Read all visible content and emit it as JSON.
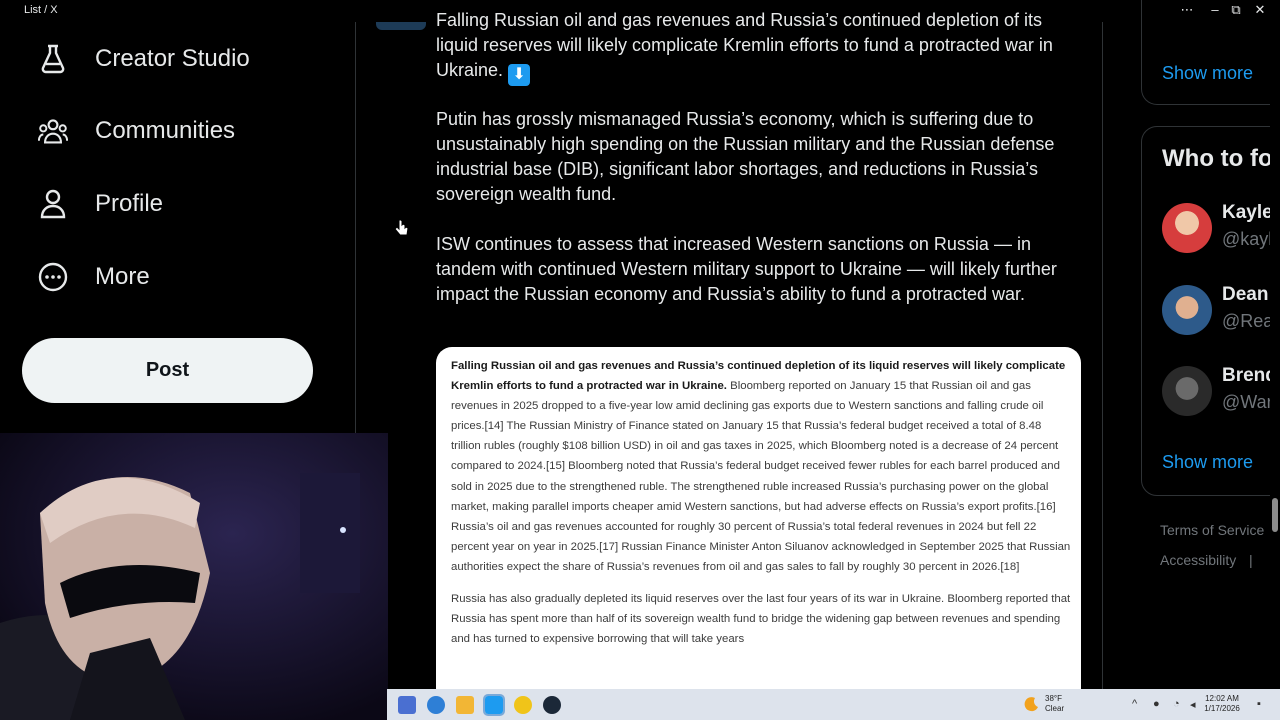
{
  "window": {
    "title": "List / X",
    "controls": [
      "⋯",
      "–",
      "⧉",
      "✕"
    ]
  },
  "nav": {
    "items": [
      {
        "label": "Creator Studio",
        "icon": "flask-icon"
      },
      {
        "label": "Communities",
        "icon": "communities-icon"
      },
      {
        "label": "Profile",
        "icon": "profile-icon"
      },
      {
        "label": "More",
        "icon": "more-circle-icon"
      }
    ],
    "post_label": "Post"
  },
  "post": {
    "paragraphs": [
      "Falling Russian oil and gas revenues and Russia’s continued depletion of its liquid reserves will likely complicate Kremlin efforts to fund a protracted war in Ukraine.",
      "Putin has grossly mismanaged Russia’s economy, which is suffering due to unsustainably high spending on the Russian military and the Russian defense industrial base (DIB), significant labor shortages, and reductions in Russia’s sovereign wealth fund.",
      "ISW continues to assess that increased Western sanctions on Russia — in tandem with continued Western military support to Ukraine — will likely further impact the Russian economy and Russia’s ability to fund a protracted war."
    ],
    "arrow_emoji": "⬇",
    "image": {
      "p1_bold": "Falling Russian oil and gas revenues and Russia’s continued depletion of its liquid reserves will likely complicate Kremlin efforts to fund a protracted war in Ukraine.",
      "p1_rest": " Bloomberg reported on January 15 that Russian oil and gas revenues in 2025 dropped to a five-year low amid declining gas exports due to Western sanctions and falling crude oil prices.[14] The Russian Ministry of Finance stated on January 15 that Russia’s federal budget received a total of 8.48 trillion rubles (roughly $108 billion USD) in oil and gas taxes in 2025, which Bloomberg noted is a decrease of 24 percent compared to 2024.[15] Bloomberg noted that Russia’s federal budget received fewer rubles for each barrel produced and sold in 2025 due to the strengthened ruble. The strengthened ruble increased Russia’s purchasing power on the global market, making parallel imports cheaper amid Western sanctions, but had adverse effects on Russia’s export profits.[16] Russia’s oil and gas revenues accounted for roughly 30 percent of Russia’s total federal revenues in 2024 but fell 22 percent year on year in 2025.[17] Russian Finance Minister Anton Siluanov acknowledged in September 2025 that Russian authorities expect the share of Russia’s revenues from oil and gas sales to fall by roughly 30 percent in 2026.[18]",
      "p2": "Russia has also gradually depleted its liquid reserves over the last four years of its war in Ukraine. Bloomberg reported that Russia has spent more than half of its sovereign wealth fund to bridge the widening gap between revenues and spending and has turned to expensive borrowing that will take years"
    }
  },
  "sidebar": {
    "show_more_top": "Show more",
    "who_title": "Who to fo",
    "who": [
      {
        "name": "Kayle",
        "handle": "@kayl",
        "color": "#c0392b"
      },
      {
        "name": "Dean",
        "handle": "@Rea",
        "color": "#3b5f86"
      },
      {
        "name": "Brend",
        "handle": "@War",
        "color": "#3a3a3a"
      }
    ],
    "show_more_who": "Show more",
    "footer": [
      "Terms of Service",
      "Accessibility",
      "|"
    ]
  },
  "taskbar": {
    "weather_temp": "38°F",
    "weather_desc": "Clear",
    "time": "12:02 AM",
    "date": "1/17/2026",
    "apps": [
      {
        "name": "calculator-icon",
        "color": "#4a6fd1"
      },
      {
        "name": "browser-globe-icon",
        "color": "#2e7fd6"
      },
      {
        "name": "file-explorer-icon",
        "color": "#f2b635"
      },
      {
        "name": "twitter-app-icon",
        "color": "#1d9bf0"
      },
      {
        "name": "pinwheel-icon",
        "color": "#f0c419"
      },
      {
        "name": "steam-icon",
        "color": "#1b2838"
      }
    ]
  }
}
